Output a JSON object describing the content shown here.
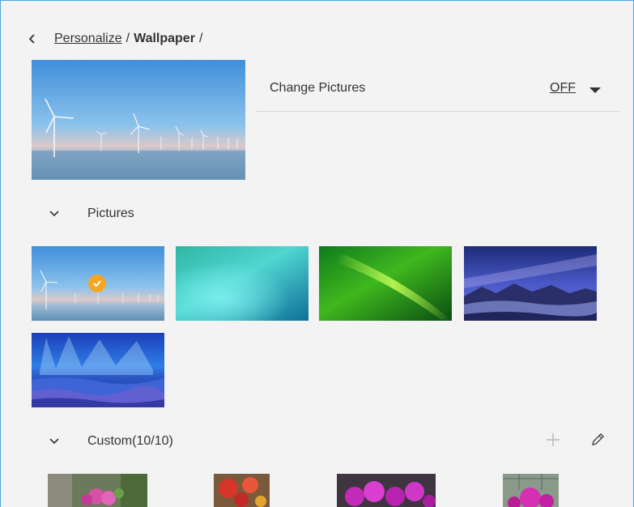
{
  "breadcrumb": {
    "parent": "Personalize",
    "separator": "/",
    "current": "Wallpaper",
    "trailing": "/"
  },
  "change_pictures": {
    "label": "Change Pictures",
    "value": "OFF"
  },
  "sections": {
    "pictures": {
      "title": "Pictures"
    },
    "custom": {
      "title": "Custom(10/10)"
    }
  },
  "colors": {
    "accent_check": "#f5a623",
    "frame_border": "#4aa8e8",
    "background": "#f3f3f3"
  },
  "icons": {
    "back": "chevron-left-icon",
    "dropdown": "caret-down-icon",
    "collapse": "chevron-down-icon",
    "add": "plus-icon",
    "edit": "pencil-icon",
    "selected": "check-icon"
  }
}
